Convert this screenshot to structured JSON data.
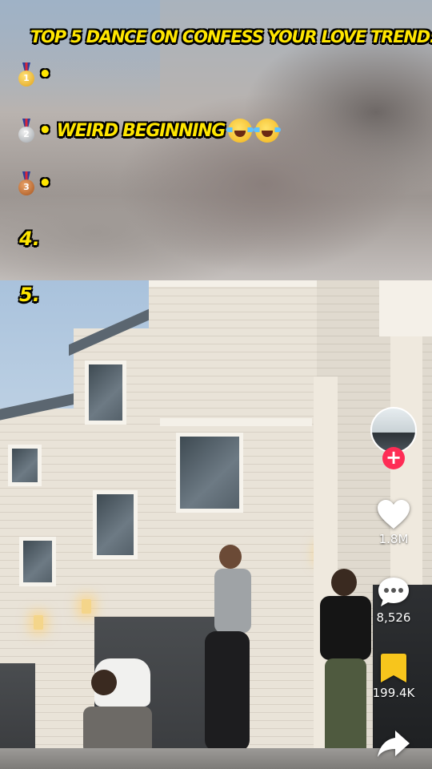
{
  "overlay": {
    "headline": "TOP 5 DANCE ON CONFESS YOUR LOVE TREND:",
    "ranks": [
      {
        "medal_number": "1",
        "dot": "•",
        "text": ""
      },
      {
        "medal_number": "2",
        "dot": "•",
        "text": "WEIRD BEGINNING"
      },
      {
        "medal_number": "3",
        "dot": "•",
        "text": ""
      },
      {
        "label": "4."
      },
      {
        "label": "5."
      }
    ],
    "emoji": [
      "face-with-tears-of-joy",
      "face-with-tears-of-joy"
    ]
  },
  "actions": {
    "likes": "1.8M",
    "comments": "8,526",
    "saves": "199.4K",
    "follow_symbol": "+"
  },
  "colors": {
    "caption_yellow": "#ffe600",
    "follow_red": "#fe2c55",
    "save_yellow": "#f7c51c"
  },
  "icons": [
    "heart-icon",
    "comment-icon",
    "bookmark-icon",
    "share-icon",
    "plus-icon"
  ]
}
